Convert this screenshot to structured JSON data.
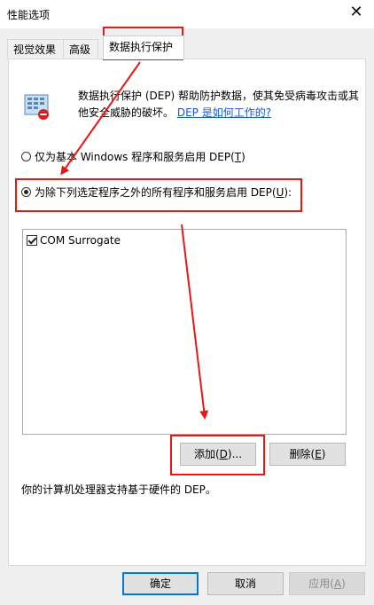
{
  "window": {
    "title": "性能选项",
    "close_icon": "close-icon"
  },
  "tabs": [
    {
      "label": "视觉效果"
    },
    {
      "label": "高级"
    },
    {
      "label": "数据执行保护",
      "active": true
    }
  ],
  "dep": {
    "description": "数据执行保护 (DEP) 帮助防护数据，使其免受病毒攻击或其他安全威胁的破坏。",
    "link": "DEP 是如何工作的?",
    "option1_prefix": "仅为基本 Windows 程序和服务启用 DEP(",
    "option1_key": "T",
    "option1_suffix": ")",
    "option2_prefix": "为除下列选定程序之外的所有程序和服务启用 DEP(",
    "option2_key": "U",
    "option2_suffix": "):",
    "selected": 2,
    "programs": [
      {
        "name": "COM Surrogate",
        "checked": true
      }
    ],
    "add_prefix": "添加(",
    "add_key": "D",
    "add_suffix": ")...",
    "remove_prefix": "删除(",
    "remove_key": "E",
    "remove_suffix": ")",
    "hardware_support": "你的计算机处理器支持基于硬件的 DEP。"
  },
  "footer": {
    "ok": "确定",
    "cancel": "取消",
    "apply_prefix": "应用(",
    "apply_key": "A",
    "apply_suffix": ")"
  },
  "annotation_color": "#e81818"
}
